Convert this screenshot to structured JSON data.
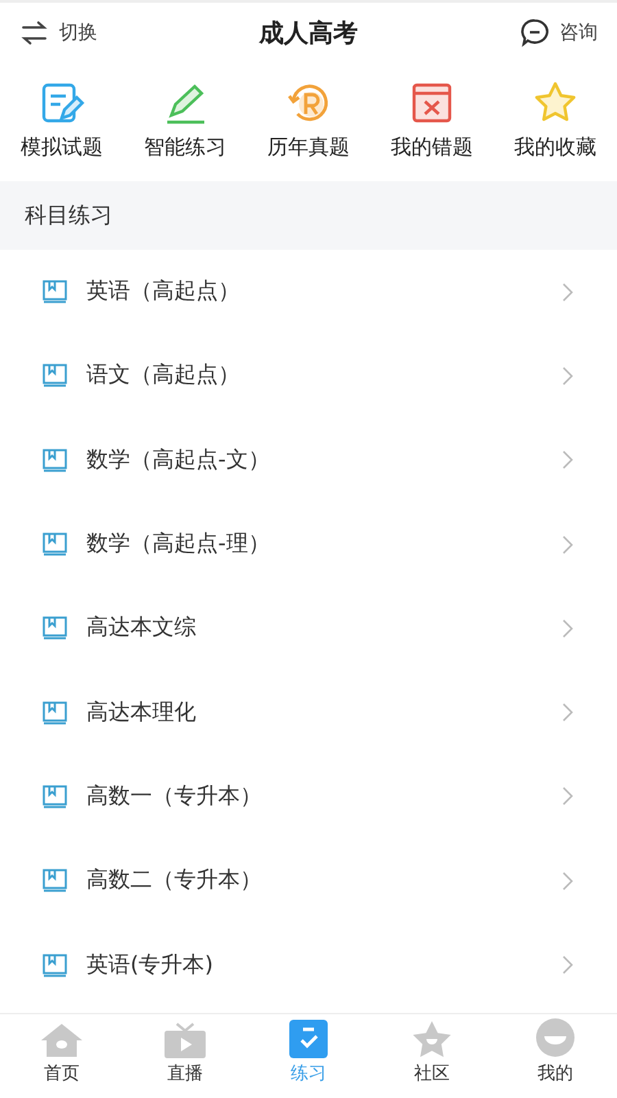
{
  "header": {
    "left": "切换",
    "title": "成人高考",
    "right": "咨询"
  },
  "shortcuts": [
    {
      "kind": "mock",
      "label": "模拟试题"
    },
    {
      "kind": "smart",
      "label": "智能练习"
    },
    {
      "kind": "past",
      "label": "历年真题"
    },
    {
      "kind": "wrong",
      "label": "我的错题"
    },
    {
      "kind": "favorite",
      "label": "我的收藏"
    }
  ],
  "section_title": "科目练习",
  "subjects": [
    "英语（高起点）",
    "语文（高起点）",
    "数学（高起点-文）",
    "数学（高起点-理）",
    "高达本文综",
    "高达本理化",
    "高数一（专升本）",
    "高数二（专升本）",
    "英语(专升本)"
  ],
  "tabs": [
    {
      "kind": "home",
      "label": "首页",
      "selected": false
    },
    {
      "kind": "live",
      "label": "直播",
      "selected": false
    },
    {
      "kind": "practice",
      "label": "练习",
      "selected": true
    },
    {
      "kind": "community",
      "label": "社区",
      "selected": false
    },
    {
      "kind": "me",
      "label": "我的",
      "selected": false
    }
  ]
}
